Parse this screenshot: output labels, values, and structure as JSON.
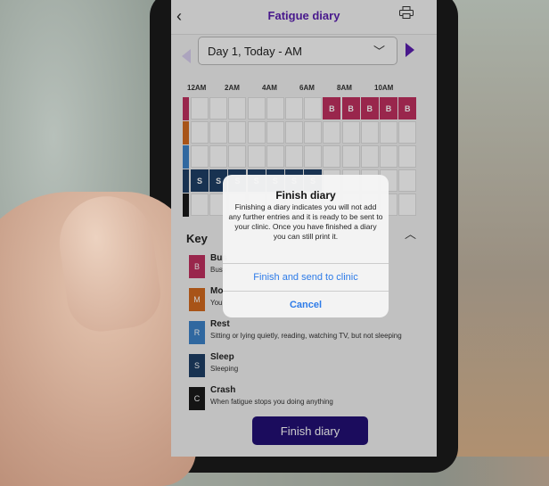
{
  "header": {
    "title": "Fatigue diary",
    "back_icon": "chevron-left-icon",
    "print_icon": "printer-icon"
  },
  "date_selector": {
    "value": "Day 1, Today - AM",
    "chevron": "⌄"
  },
  "nav": {
    "prev": "prev-day",
    "next": "next-day"
  },
  "hour_labels": [
    "12AM",
    "2AM",
    "4AM",
    "6AM",
    "8AM",
    "10AM"
  ],
  "grid": {
    "hours": 12,
    "rows": [
      {
        "category": "Busy",
        "color": "#c0305f",
        "letter": "B",
        "filled": [
          7,
          8,
          9,
          10,
          11
        ]
      },
      {
        "category": "Moderate",
        "color": "#d2691e",
        "letter": "M",
        "filled": []
      },
      {
        "category": "Rest",
        "color": "#3c82c8",
        "letter": "R",
        "filled": []
      },
      {
        "category": "Sleep",
        "color": "#1f3f66",
        "letter": "S",
        "filled": [
          0,
          1,
          2,
          3,
          4,
          5,
          6
        ]
      },
      {
        "category": "Crash",
        "color": "#1a1a1a",
        "letter": "C",
        "filled": []
      }
    ]
  },
  "key": {
    "title": "Key",
    "items": [
      {
        "letter": "B",
        "name": "Bus",
        "desc": "Busy",
        "color": "#c0305f"
      },
      {
        "letter": "M",
        "name": "Mo",
        "desc": "You'",
        "color": "#d2691e"
      },
      {
        "letter": "R",
        "name": "Rest",
        "desc": "Sitting or lying quietly, reading, watching TV, but not sleeping",
        "color": "#3c82c8"
      },
      {
        "letter": "S",
        "name": "Sleep",
        "desc": "Sleeping",
        "color": "#1f3f66"
      },
      {
        "letter": "C",
        "name": "Crash",
        "desc": "When fatigue stops you doing anything",
        "color": "#1a1a1a"
      }
    ]
  },
  "finish_button": "Finish diary",
  "dialog": {
    "title": "Finish diary",
    "message": "Finishing a diary indicates you will not add any further entries and it is ready to be sent to your clinic. Once you have finished a diary you can still print it.",
    "confirm": "Finish and send to clinic",
    "cancel": "Cancel"
  }
}
